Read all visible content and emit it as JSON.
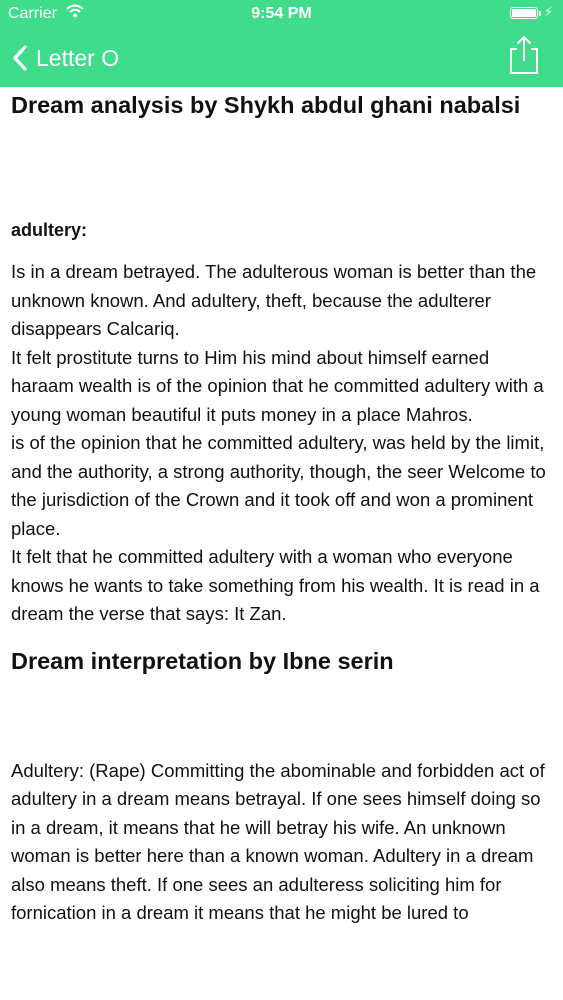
{
  "status_bar": {
    "carrier": "Carrier",
    "time": "9:54 PM",
    "battery_level": 1.0
  },
  "nav": {
    "back_label": "Letter O",
    "back_icon": "chevron-left-icon",
    "share_icon": "share-icon"
  },
  "colors": {
    "nav_background": "#3fdc8c",
    "nav_foreground": "#ffffff"
  },
  "sections": [
    {
      "title": "Dream analysis by Shykh abdul ghani nabalsi",
      "term": "adultery:",
      "body": "Is in a dream betrayed. The adulterous woman is better than the unknown known. And adultery, theft, because the adulterer disappears Calcariq.\nIt felt prostitute turns to Him his mind about himself earned haraam wealth is of the opinion that he committed adultery with a young woman beautiful it puts money in a place Mahros.\nis of the opinion that he committed adultery, was held by the limit, and the authority, a strong authority, though, the seer Welcome to the jurisdiction of the Crown and it took off and won a prominent place.\nIt felt that he committed adultery with a woman who everyone knows he wants to take something from his wealth. It is read in a dream the verse that says:  It Zan."
    },
    {
      "title": "Dream interpretation by Ibne serin",
      "body": "Adultery: (Rape) Committing the abominable and forbidden act of adultery in a dream means betrayal. If one sees himself doing so in a dream, it means that he will betray his wife. An unknown woman is better here than a known woman. Adultery in a dream also means theft. If one sees an adulteress soliciting him for fornication in a dream it means that he might be lured to"
    }
  ]
}
